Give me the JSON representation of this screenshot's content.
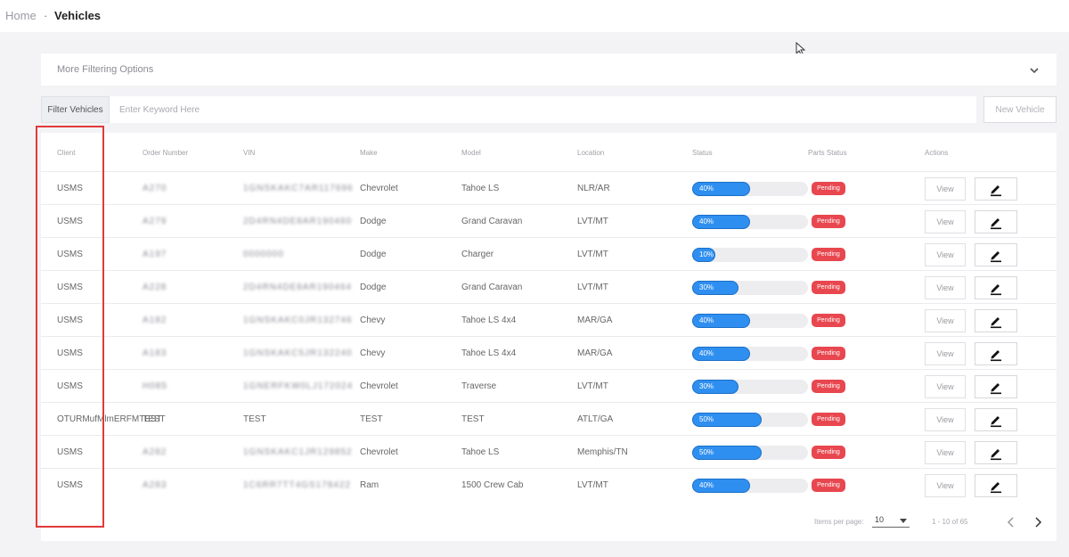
{
  "breadcrumb": {
    "home": "Home",
    "separator": "·",
    "current": "Vehicles"
  },
  "filter_panel": {
    "label": "More Filtering Options",
    "icon": "chevron-down-icon"
  },
  "search": {
    "button_label": "Filter Vehicles",
    "placeholder": "Enter Keyword Here",
    "value": ""
  },
  "new_vehicle_label": "New Vehicle",
  "table": {
    "columns": [
      "Client",
      "Order Number",
      "VIN",
      "Make",
      "Model",
      "Location",
      "Status",
      "Parts Status",
      "Actions"
    ],
    "rows": [
      {
        "client": "USMS",
        "order": "A270",
        "vin": "1GNSKAKC7AR117696",
        "make": "Chevrolet",
        "model": "Tahoe LS",
        "location": "NLR/AR",
        "status": "40%",
        "status_value": 40,
        "parts_status": "Pending",
        "view": "View"
      },
      {
        "client": "USMS",
        "order": "A279",
        "vin": "2D4RN4DE8AR190460",
        "make": "Dodge",
        "model": "Grand Caravan",
        "location": "LVT/MT",
        "status": "40%",
        "status_value": 40,
        "parts_status": "Pending",
        "view": "View"
      },
      {
        "client": "USMS",
        "order": "A197",
        "vin": "0000000",
        "make": "Dodge",
        "model": "Charger",
        "location": "LVT/MT",
        "status": "10%",
        "status_value": 10,
        "parts_status": "Pending",
        "view": "View"
      },
      {
        "client": "USMS",
        "order": "A228",
        "vin": "2D4RN4DE8AR190464",
        "make": "Dodge",
        "model": "Grand Caravan",
        "location": "LVT/MT",
        "status": "30%",
        "status_value": 30,
        "parts_status": "Pending",
        "view": "View"
      },
      {
        "client": "USMS",
        "order": "A182",
        "vin": "1GNSKAKC0JR132746",
        "make": "Chevy",
        "model": "Tahoe LS 4x4",
        "location": "MAR/GA",
        "status": "40%",
        "status_value": 40,
        "parts_status": "Pending",
        "view": "View"
      },
      {
        "client": "USMS",
        "order": "A183",
        "vin": "1GNSKAKC5JR132240",
        "make": "Chevy",
        "model": "Tahoe LS 4x4",
        "location": "MAR/GA",
        "status": "40%",
        "status_value": 40,
        "parts_status": "Pending",
        "view": "View"
      },
      {
        "client": "USMS",
        "order": "H085",
        "vin": "1GNERFKW0LJ172024",
        "make": "Chevrolet",
        "model": "Traverse",
        "location": "LVT/MT",
        "status": "30%",
        "status_value": 30,
        "parts_status": "Pending",
        "view": "View"
      },
      {
        "client": "OTURMufMlmERFMTEST",
        "order": "TEST",
        "vin": "TEST",
        "make": "TEST",
        "model": "TEST",
        "location": "ATLT/GA",
        "status": "50%",
        "status_value": 50,
        "parts_status": "Pending",
        "view": "View",
        "clear": true
      },
      {
        "client": "USMS",
        "order": "A282",
        "vin": "1GNSKAKC1JR129852",
        "make": "Chevrolet",
        "model": "Tahoe LS",
        "location": "Memphis/TN",
        "status": "50%",
        "status_value": 50,
        "parts_status": "Pending",
        "view": "View"
      },
      {
        "client": "USMS",
        "order": "A283",
        "vin": "1C6RR7TT4GS178422",
        "make": "Ram",
        "model": "1500 Crew Cab",
        "location": "LVT/MT",
        "status": "40%",
        "status_value": 40,
        "parts_status": "Pending",
        "view": "View"
      }
    ]
  },
  "pagination": {
    "items_per_page_label": "Items per page:",
    "page_size": "10",
    "range": "1 - 10 of 65"
  },
  "colors": {
    "progress": "#2f8ff0",
    "pending": "#e8474f",
    "highlight": "#e03a3a"
  }
}
